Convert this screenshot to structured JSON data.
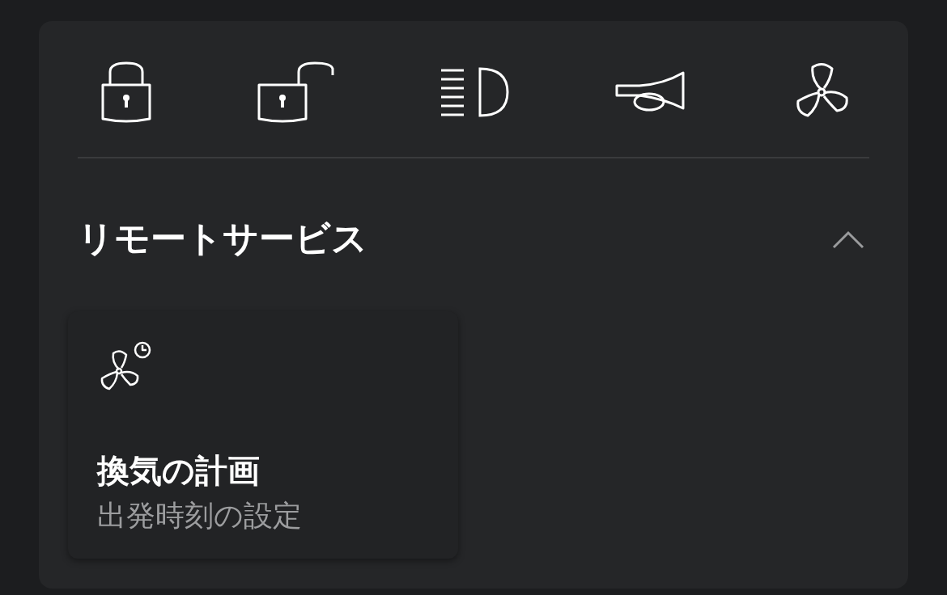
{
  "section": {
    "title": "リモートサービス",
    "expanded": true
  },
  "services": [
    {
      "title": "換気の計画",
      "subtitle": "出発時刻の設定"
    }
  ]
}
